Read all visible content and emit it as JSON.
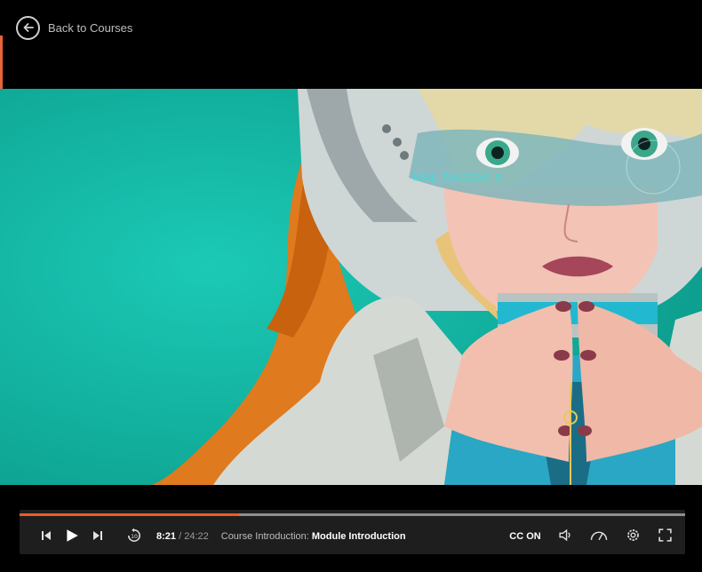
{
  "nav": {
    "back_label": "Back to Courses"
  },
  "player": {
    "progress_fraction": 0.33,
    "current_time": "8:21",
    "separator": "/",
    "duration": "24:22",
    "course_prefix": "Course Introduction:",
    "module_title": "Module Introduction",
    "cc_label": "CC ON"
  },
  "video": {
    "overlay_text": "NSAL PHASSING D"
  },
  "icons": {
    "back": "arrow-left-circle-icon",
    "prev": "skip-previous-icon",
    "play": "play-icon",
    "next": "skip-next-icon",
    "rewind": "rewind-10-icon",
    "volume": "volume-icon",
    "speed": "speedometer-icon",
    "settings": "gear-icon",
    "fullscreen": "fullscreen-icon"
  },
  "colors": {
    "accent": "#f05a28",
    "video_bg": "#16bba6",
    "control_bg": "#1e1e1e"
  }
}
